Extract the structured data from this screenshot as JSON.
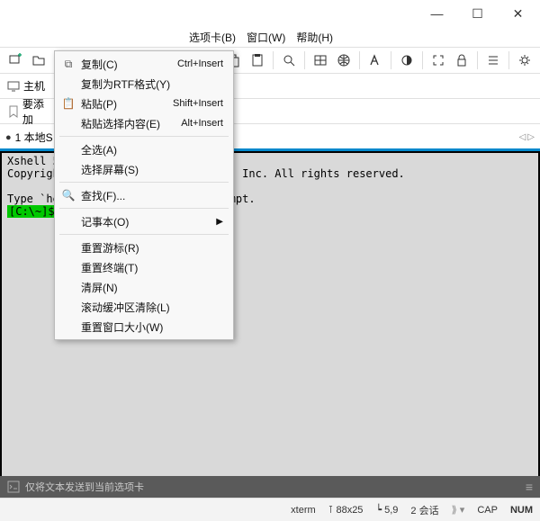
{
  "titlebar": {
    "min": "—",
    "max": "☐",
    "close": "✕"
  },
  "menubar": {
    "tabs": "选项卡(B)",
    "window": "窗口(W)",
    "help": "帮助(H)"
  },
  "sidebar": {
    "host": "主机",
    "add": "要添加"
  },
  "tab": {
    "name": "1 本地S"
  },
  "terminal": {
    "line1a": "Xshell 5",
    "line2a": "Copyright",
    "line2b": "ter, Inc. All rights reserved.",
    "line3a": "Type `hel",
    "line3b": "prompt.",
    "prompt": "[C:\\~]$"
  },
  "ctx": {
    "copy": "复制(C)",
    "copy_sc": "Ctrl+Insert",
    "copy_rtf": "复制为RTF格式(Y)",
    "paste": "粘贴(P)",
    "paste_sc": "Shift+Insert",
    "paste_sel": "粘贴选择内容(E)",
    "paste_sel_sc": "Alt+Insert",
    "select_all": "全选(A)",
    "select_screen": "选择屏幕(S)",
    "find": "查找(F)...",
    "notepad": "记事本(O)",
    "reset_cursor": "重置游标(R)",
    "reset_term": "重置终端(T)",
    "clear": "清屏(N)",
    "scroll_clear": "滚动缓冲区清除(L)",
    "reset_winsize": "重置窗口大小(W)"
  },
  "status1": {
    "text": "仅将文本发送到当前选项卡",
    "more": "≡"
  },
  "status2": {
    "xterm": "xterm",
    "size": "88x25",
    "pos": "5,9",
    "sess": "2 会话",
    "cap": "CAP",
    "num": "NUM"
  }
}
